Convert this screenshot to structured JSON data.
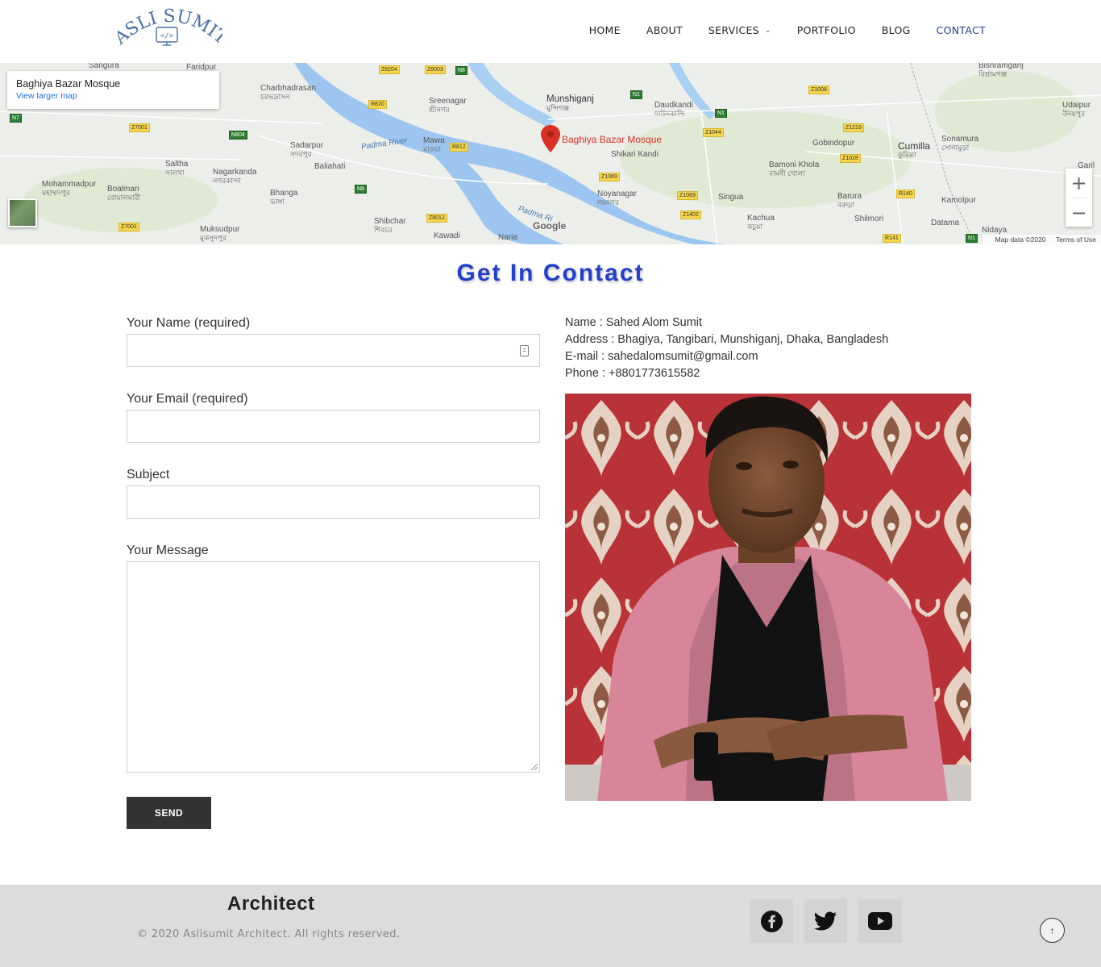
{
  "header": {
    "logo_text": "ASLI SUMIT",
    "nav": {
      "home": "HOME",
      "about": "ABOUT",
      "services": "SERVICES",
      "portfolio": "PORTFOLIO",
      "blog": "BLOG",
      "contact": "CONTACT"
    }
  },
  "map": {
    "place_title": "Baghiya Bazar Mosque",
    "larger_map_link": "View larger map",
    "marker_label": "Baghiya Bazar Mosque",
    "zoom_in": "+",
    "zoom_out": "−",
    "attribution": "Map data ©2020",
    "terms": "Terms of Use",
    "google": "Google",
    "places": [
      {
        "name": "Sangura"
      },
      {
        "name": "Faridpur"
      },
      {
        "name": "Charbhadrasan",
        "bn": "চরভদ্রাসন"
      },
      {
        "name": "Sreenagar",
        "bn": "শ্রীনগর"
      },
      {
        "name": "Munshiganj",
        "bn": "মুন্সিগঞ্জ"
      },
      {
        "name": "Daudkandi",
        "bn": "দাউদকান্দি"
      },
      {
        "name": "Sadarpur",
        "bn": "সদরপুর"
      },
      {
        "name": "Baliahati"
      },
      {
        "name": "Mawa",
        "bn": "মাওয়া"
      },
      {
        "name": "Shikari Kandi"
      },
      {
        "name": "Gobindopur"
      },
      {
        "name": "Cumilla",
        "bn": "কুমিল্লা"
      },
      {
        "name": "Sonamura",
        "bn": "সোনামুড়া"
      },
      {
        "name": "Udaipur",
        "bn": "উদয়পুর"
      },
      {
        "name": "Saltha",
        "bn": "সালথা"
      },
      {
        "name": "Nagarkanda",
        "bn": "নগরকান্দা"
      },
      {
        "name": "Mohammadpur",
        "bn": "মহাম্মদপুর"
      },
      {
        "name": "Boalmari",
        "bn": "বোয়ালমারী"
      },
      {
        "name": "Bhanga",
        "bn": "ভাঙ্গা"
      },
      {
        "name": "Shibchar",
        "bn": "শিবচর"
      },
      {
        "name": "Kawadi"
      },
      {
        "name": "Naria"
      },
      {
        "name": "Noyanagar",
        "bn": "নয়নগর"
      },
      {
        "name": "Singua"
      },
      {
        "name": "Bamoni Khola",
        "bn": "বামনী খোলা"
      },
      {
        "name": "Barura",
        "bn": "বরুড়া"
      },
      {
        "name": "Kachua",
        "bn": "কচুয়া"
      },
      {
        "name": "Shilmori"
      },
      {
        "name": "Kamolpur"
      },
      {
        "name": "Datama"
      },
      {
        "name": "Nidaya"
      },
      {
        "name": "Muksudpur",
        "bn": "মুকসুদপুর"
      },
      {
        "name": "Bishramganj",
        "bn": "বিশ্রামগঞ্জ"
      },
      {
        "name": "Garil"
      }
    ],
    "rivers": [
      "Padma River",
      "Padma Ri"
    ],
    "roads": [
      "Z8204",
      "Z8003",
      "N8",
      "R820",
      "N1",
      "N1",
      "N7",
      "Z7001",
      "N804",
      "R812",
      "Z1044",
      "Z1008",
      "Z1219",
      "Z1028",
      "Z1069",
      "N8",
      "Z8012",
      "Z1069",
      "Z1402",
      "R140",
      "Z7001",
      "R141",
      "N1"
    ]
  },
  "heading": "Get In Contact",
  "form": {
    "name_label": "Your Name (required)",
    "email_label": "Your Email (required)",
    "subject_label": "Subject",
    "message_label": "Your Message",
    "send_label": "SEND"
  },
  "contact": {
    "name": "Name : Sahed Alom Sumit",
    "address": "Address : Bhagiya, Tangibari, Munshiganj, Dhaka, Bangladesh",
    "email": "E-mail : sahedalomsumit@gmail.com",
    "phone": "Phone : +8801773615582"
  },
  "footer": {
    "brand": "Architect",
    "copyright": "© 2020 Aslisumit Architect. All rights reserved.",
    "social": [
      "facebook-icon",
      "twitter-icon",
      "youtube-icon"
    ],
    "to_top": "↑"
  },
  "colors": {
    "accent": "#2340c9",
    "nav_active": "#24408e",
    "button": "#333333",
    "footer_bg": "#dcdcdc",
    "map_water": "#9cc6f0",
    "marker": "#d93025"
  }
}
